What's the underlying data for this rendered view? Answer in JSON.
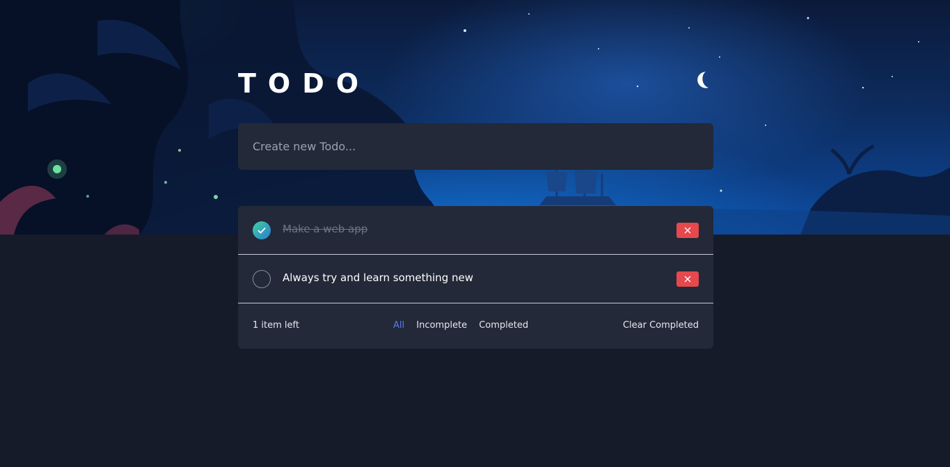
{
  "app": {
    "title": "TODO"
  },
  "theme": {
    "icon": "moon-icon",
    "accent": "#4f7df5",
    "delete_color": "#e5484d"
  },
  "new_todo": {
    "placeholder": "Create new Todo...",
    "value": ""
  },
  "todos": [
    {
      "text": "Make a web app",
      "completed": true
    },
    {
      "text": "Always try and learn something new",
      "completed": false
    }
  ],
  "footer": {
    "items_left": "1 item left",
    "filters": [
      "All",
      "Incomplete",
      "Completed"
    ],
    "active_filter": "All",
    "clear_label": "Clear Completed"
  }
}
